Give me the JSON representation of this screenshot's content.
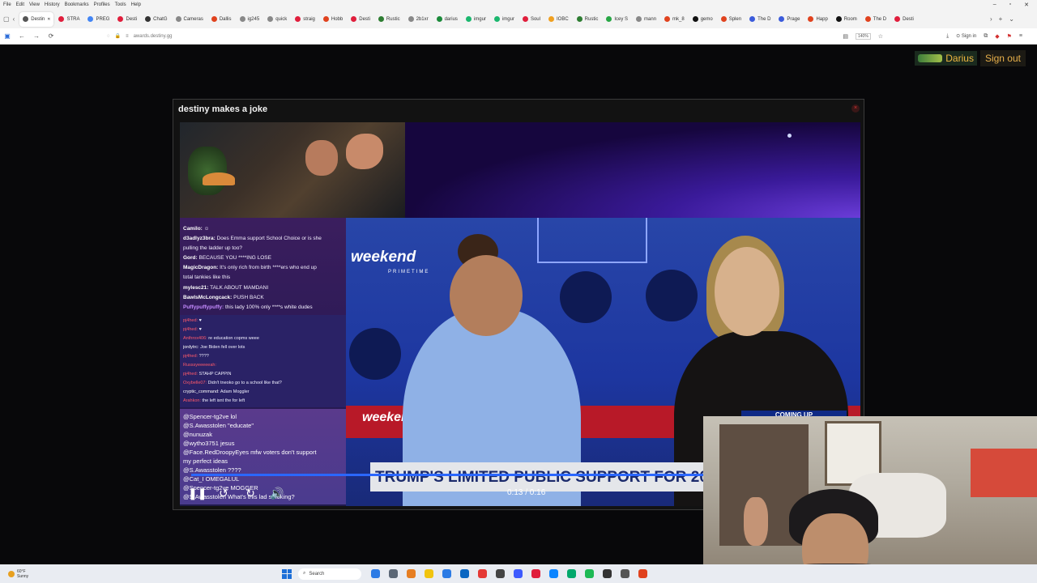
{
  "browser": {
    "menu": [
      "File",
      "Edit",
      "View",
      "History",
      "Bookmarks",
      "Profiles",
      "Tools",
      "Help"
    ],
    "tabs": [
      {
        "label": "Destin",
        "color": "#555555",
        "active": true
      },
      {
        "label": "STRA",
        "color": "#e01e3c"
      },
      {
        "label": "PREG",
        "color": "#4285f4"
      },
      {
        "label": "Desti",
        "color": "#e01e3c"
      },
      {
        "label": "ChatG",
        "color": "#333333"
      },
      {
        "label": "Cameras",
        "color": "#888888"
      },
      {
        "label": "Dallis",
        "color": "#e0421e"
      },
      {
        "label": "ig245",
        "color": "#888888"
      },
      {
        "label": "quick",
        "color": "#888888"
      },
      {
        "label": "straig",
        "color": "#e01e3c"
      },
      {
        "label": "Hobb",
        "color": "#e0421e"
      },
      {
        "label": "Desti",
        "color": "#e01e3c"
      },
      {
        "label": "Rustic",
        "color": "#2e7d32"
      },
      {
        "label": "2b1xr",
        "color": "#888888"
      },
      {
        "label": "darius",
        "color": "#1b8a3a"
      },
      {
        "label": "imgur",
        "color": "#1bb76e"
      },
      {
        "label": "imgur",
        "color": "#1bb76e"
      },
      {
        "label": "Soul",
        "color": "#e01e3c"
      },
      {
        "label": "IOBC",
        "color": "#f0a020"
      },
      {
        "label": "Rustic",
        "color": "#2e7d32"
      },
      {
        "label": "Icey S",
        "color": "#28a745"
      },
      {
        "label": "mann",
        "color": "#888888"
      },
      {
        "label": "mk_8",
        "color": "#e0421e"
      },
      {
        "label": "gemo",
        "color": "#111111"
      },
      {
        "label": "Splen",
        "color": "#e0421e"
      },
      {
        "label": "The D",
        "color": "#3b5bdb"
      },
      {
        "label": "Prage",
        "color": "#3b5bdb"
      },
      {
        "label": "Happ",
        "color": "#e0421e"
      },
      {
        "label": "Room",
        "color": "#111111"
      },
      {
        "label": "The D",
        "color": "#e0421e"
      },
      {
        "label": "Desti",
        "color": "#e01e3c"
      }
    ],
    "url": "awards.destiny.gg",
    "zoom": "140%",
    "sign_in": "Sign in"
  },
  "page": {
    "user_name": "Darius",
    "sign_out": "Sign out"
  },
  "modal": {
    "title": "destiny makes a joke",
    "close_glyph": "×"
  },
  "chat": {
    "top": [
      {
        "user": "Camilo:",
        "color": "#ffffff",
        "text": " ☺"
      },
      {
        "user": "d3adlyz3bra:",
        "color": "#ffffff",
        "text": " Does Emma support School Choice or is she"
      },
      {
        "user": "",
        "color": "#ffffff",
        "text": "pulling the ladder up too?"
      },
      {
        "user": "Gord:",
        "color": "#ffffff",
        "text": " BECAUSE YOU ****ING LOSE"
      },
      {
        "user": "MagicDragon:",
        "color": "#ffffff",
        "text": " It's only rich from birth ****ers who end up"
      },
      {
        "user": "",
        "color": "#ffffff",
        "text": "total tankies like this"
      },
      {
        "user": "mylesc21:",
        "color": "#ffffff",
        "text": " TALK ABOUT MAMDANI"
      },
      {
        "user": "BawlsMcLongcack:",
        "color": "#ffffff",
        "text": " PUSH BACK"
      },
      {
        "user": "Puffypuffypuffy:",
        "color": "#c58bff",
        "text": " this lady 100% only ****s white dudes"
      }
    ],
    "mid": [
      {
        "user": "pj4hed:",
        "color": "#ff5a6a",
        "text": " ♥"
      },
      {
        "user": "pj4hed:",
        "color": "#ff5a6a",
        "text": " ♥"
      },
      {
        "user": "Anthrox406:",
        "color": "#ff5a6a",
        "text": " re education copms weee"
      },
      {
        "user": "jordytrc:",
        "color": "#ffffff",
        "text": " Joe Biden fell over lots"
      },
      {
        "user": "pj4hed:",
        "color": "#ff5a6a",
        "text": " ????"
      },
      {
        "user": "Russsyeeeeeah:",
        "color": "#ff5a6a",
        "text": ""
      },
      {
        "user": "pj4hed:",
        "color": "#ff5a6a",
        "text": " STAHP CAPPIN"
      },
      {
        "user": "Oxybelle07:",
        "color": "#ff5a6a",
        "text": " Didn't tneoko go to a school like that?"
      },
      {
        "user": "cryptic_command:",
        "color": "#ffffff",
        "text": " Adam Moggler"
      },
      {
        "user": "Arahkon:",
        "color": "#ff5a6a",
        "text": " the left isnt the for left"
      }
    ],
    "bottom": [
      "@Spencer-tg2ve lol",
      "@S.Awasstolen \"educate\"",
      "@nunuzak",
      "@wytho3751 jesus",
      "@Face.RedDroopyEyes mfw voters don't support",
      "my perfect ideas",
      "@S.Awasstolen ????",
      "@Cat_I OMEGALUL",
      "@Spencer-tg2ve MOGGER",
      "@S.Awasstolen What's this lad smoking?"
    ]
  },
  "news": {
    "logo": "weekend",
    "logo_sub": "PRIMETIME",
    "logo_small": "weekend",
    "coming_up": "COMING UP",
    "headline": "TRUMP'S LIMITED PUBLIC SUPPORT FOR 2025 GOP CANDI"
  },
  "player": {
    "progress": 0.8125,
    "time": "0:13 / 0:16",
    "pause_glyph": "❚❚",
    "rewind_glyph": "↺",
    "forward_glyph": "↻",
    "volume_glyph": "🔊"
  },
  "taskbar": {
    "temp": "60°F",
    "condition": "Sunny",
    "search": "Search",
    "icon_colors": [
      "#2c7be5",
      "#5b6776",
      "#e67e22",
      "#f1c40f",
      "#2c7be5",
      "#0a66c2",
      "#e53935",
      "#444444",
      "#3d5afe",
      "#e01e3c",
      "#0a84ff",
      "#00a86b",
      "#1db954",
      "#333333",
      "#555555",
      "#e0421e"
    ]
  }
}
